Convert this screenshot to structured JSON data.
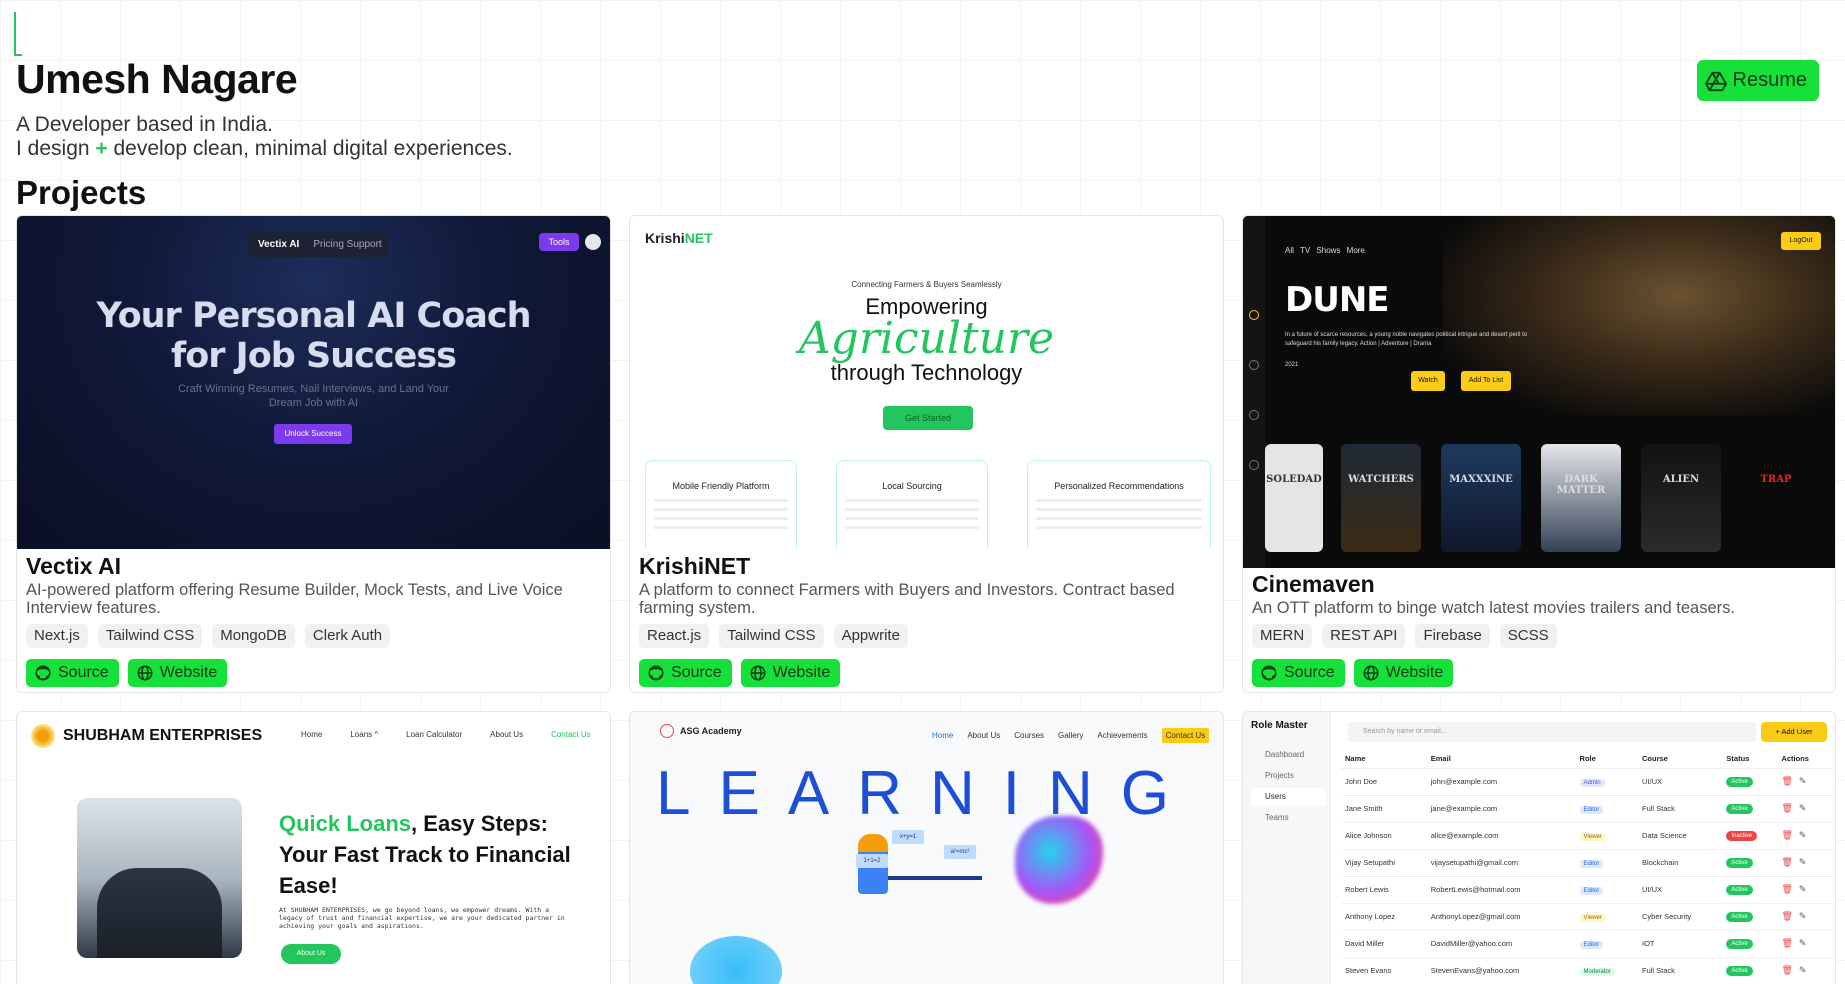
{
  "header": {
    "name": "Umesh Nagare",
    "tagline_1": "A Developer based in India.",
    "tagline_2_before": "I design ",
    "tagline_2_plus": "+",
    "tagline_2_after": " develop clean, minimal digital experiences.",
    "resume_label": "Resume",
    "resume_icon": "google-drive-icon"
  },
  "section_title": "Projects",
  "colors": {
    "accent": "#16e03a",
    "accent_text": "#0b3b10"
  },
  "projects": [
    {
      "title": "Vectix AI",
      "description": "AI-powered platform offering Resume Builder, Mock Tests, and Live Voice Interview features.",
      "tech": [
        "Next.js",
        "Tailwind CSS",
        "MongoDB",
        "Clerk Auth"
      ],
      "source_label": "Source",
      "website_label": "Website",
      "preview": {
        "nav_brand": "Vectix AI",
        "nav_links": "Pricing   Support",
        "tools": "Tools",
        "headline_1": "Your Personal AI Coach",
        "headline_2": "for Job Success",
        "sub_1": "Craft Winning Resumes, Nail Interviews, and Land Your",
        "sub_2": "Dream Job with AI",
        "cta": "Unlock Success"
      }
    },
    {
      "title": "KrishiNET",
      "description": "A platform to connect Farmers with Buyers and Investors. Contract based farming system.",
      "tech": [
        "React.js",
        "Tailwind CSS",
        "Appwrite"
      ],
      "source_label": "Source",
      "website_label": "Website",
      "preview": {
        "logo_a": "Krishi",
        "logo_b": "NET",
        "small": "Connecting Farmers & Buyers Seamlessly",
        "h1": "Empowering",
        "agri": "Agriculture",
        "h3": "through Technology",
        "cta": "Get Started",
        "features": [
          "Mobile Friendly Platform",
          "Local Sourcing",
          "Personalized Recommendations"
        ]
      }
    },
    {
      "title": "Cinemaven",
      "description": "An OTT platform to binge watch latest movies trailers and teasers.",
      "tech": [
        "MERN",
        "REST API",
        "Firebase",
        "SCSS"
      ],
      "source_label": "Source",
      "website_label": "Website",
      "preview": {
        "nav": "All  TV Shows  More",
        "logout": "LogOut",
        "movie": "DUNE",
        "blurb": "In a future of scarce resources, a young noble navigates political intrigue and desert peril to safeguard his family legacy. Action | Adventure | Drama",
        "year": "2021",
        "watch": "Watch",
        "add": "Add To List",
        "posters": [
          "SOLEDAD",
          "WATCHERS",
          "MAXXXINE",
          "DARK MATTER",
          "ALIEN",
          "TRAP"
        ]
      }
    },
    {
      "preview": {
        "brand": "SHUBHAM ENTERPRISES",
        "nav": [
          "Home",
          "Loans ^",
          "Loan Calculator",
          "About Us",
          "Contact Us"
        ],
        "h_accent": "Quick Loans",
        "h_rest": ", Easy Steps: Your Fast Track to Financial Ease!",
        "para": "At SHUBHAM ENTERPRISES, we go beyond loans, we empower dreams. With a legacy of trust and financial expertise, we are your dedicated partner in achieving your goals and aspirations.",
        "cta": "About Us"
      }
    },
    {
      "preview": {
        "brand": "ASG Academy",
        "nav": [
          "Home",
          "About Us",
          "Courses",
          "Gallery",
          "Achievements"
        ],
        "contact": "Contact Us",
        "headline": "LEARNING",
        "b1": "x+y=1",
        "b2": "1+1=2",
        "b3": "a²=mc²"
      }
    },
    {
      "preview": {
        "brand": "Role Master",
        "side": [
          "Dashboard",
          "Projects",
          "Users",
          "Teams"
        ],
        "search": "Search by name or email...",
        "add": "+ Add User",
        "columns": [
          "Name",
          "Email",
          "Role",
          "Course",
          "Status",
          "Actions"
        ],
        "rows": [
          [
            "John Doe",
            "john@example.com",
            "Admin",
            "UI/UX",
            "Active"
          ],
          [
            "Jane Smith",
            "jane@example.com",
            "Editor",
            "Full Stack",
            "Active"
          ],
          [
            "Alice Johnson",
            "alice@example.com",
            "Viewer",
            "Data Science",
            "Inactive"
          ],
          [
            "Vijay Setupathi",
            "vijaysetupathi@gmail.com",
            "Editor",
            "Blockchain",
            "Active"
          ],
          [
            "Robert Lewis",
            "RobertLewis@hotmail.com",
            "Editor",
            "UI/UX",
            "Active"
          ],
          [
            "Anthony Lopez",
            "AnthonyLopez@gmail.com",
            "Viewer",
            "Cyber Security",
            "Active"
          ],
          [
            "David Miller",
            "DavidMiller@yahoo.com",
            "Editor",
            "IOT",
            "Active"
          ],
          [
            "Steven Evans",
            "StevenEvans@yahoo.com",
            "Moderator",
            "Full Stack",
            "Active"
          ]
        ]
      }
    }
  ]
}
